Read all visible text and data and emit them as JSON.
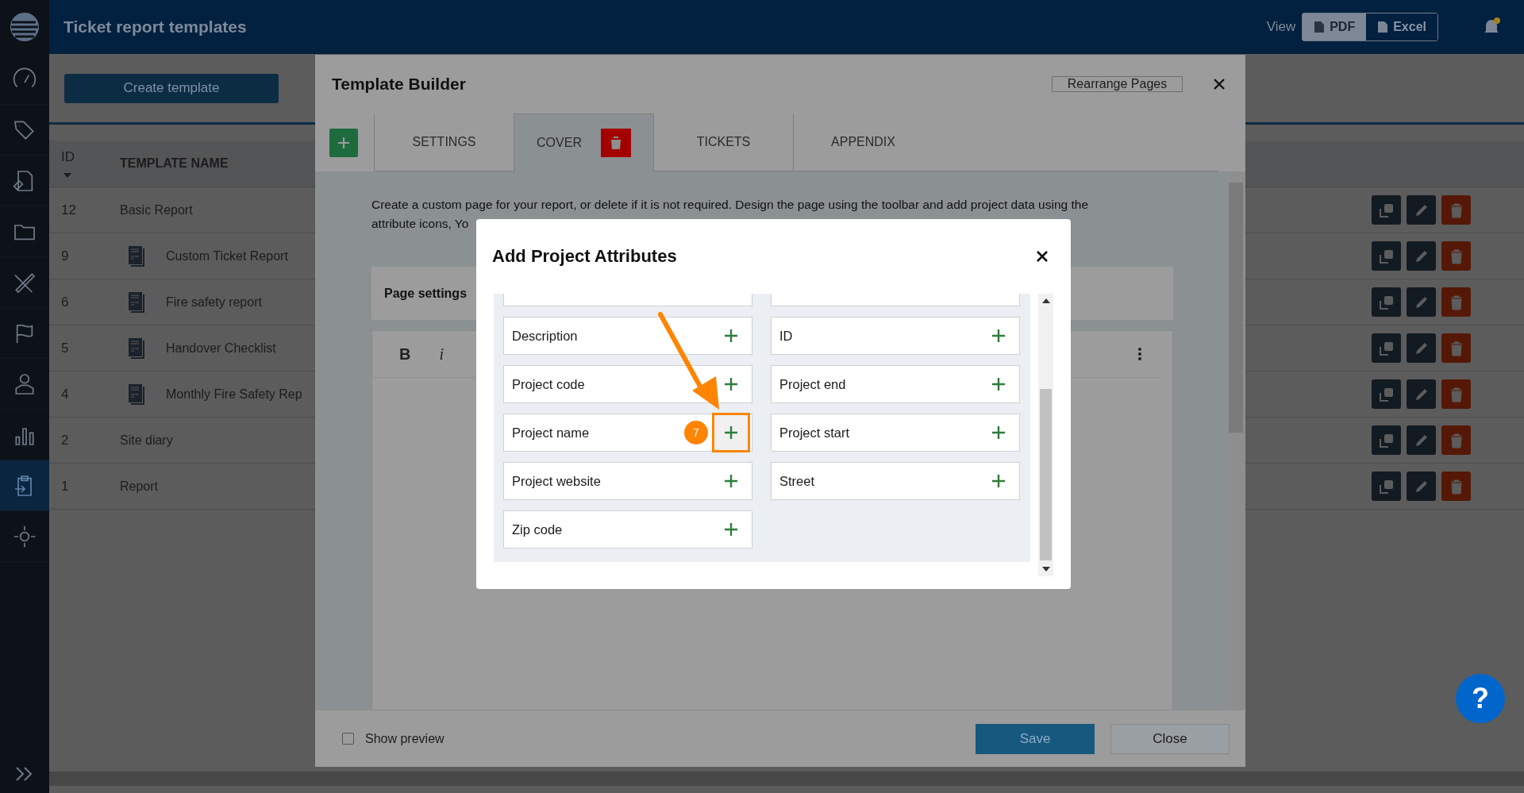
{
  "app": {
    "title": "Ticket report templates",
    "view_label": "View",
    "export_buttons": [
      "PDF",
      "Excel"
    ]
  },
  "sidebar": {
    "items": [
      {
        "selected": false
      },
      {
        "selected": false
      },
      {
        "selected": false
      },
      {
        "selected": false
      },
      {
        "selected": false
      },
      {
        "selected": false
      },
      {
        "selected": false
      },
      {
        "selected": false
      },
      {
        "selected": true
      },
      {
        "selected": false
      }
    ]
  },
  "create_button": "Create template",
  "table": {
    "columns": [
      "ID",
      "TEMPLATE NAME"
    ],
    "rows": [
      {
        "id": "12",
        "name": "Basic Report",
        "kind": "plain"
      },
      {
        "id": "9",
        "name": "Custom Ticket Report",
        "kind": "document"
      },
      {
        "id": "6",
        "name": "Fire safety report",
        "kind": "document"
      },
      {
        "id": "5",
        "name": "Handover Checklist",
        "kind": "document"
      },
      {
        "id": "4",
        "name": "Monthly Fire Safety Rep",
        "kind": "document"
      },
      {
        "id": "2",
        "name": "Site diary",
        "kind": "plain"
      },
      {
        "id": "1",
        "name": "Report",
        "kind": "plain"
      }
    ]
  },
  "builder": {
    "title": "Template Builder",
    "rearrange_button": "Rearrange Pages",
    "tabs": [
      {
        "label": "SETTINGS",
        "selected": false,
        "deletable": false
      },
      {
        "label": "COVER",
        "selected": true,
        "deletable": true
      },
      {
        "label": "TICKETS",
        "selected": false,
        "deletable": false
      },
      {
        "label": "APPENDIX",
        "selected": false,
        "deletable": false
      }
    ],
    "description_lines": [
      "Create a custom page for your report, or delete if it is not required. Design the page using the toolbar and add project data using the",
      "attribute icons, Yo"
    ],
    "page_settings": "Page settings",
    "toolbar": [
      "B",
      "i"
    ],
    "show_preview": {
      "label": "Show preview",
      "checked": false
    },
    "save_button": "Save",
    "close_button": "Close"
  },
  "dialog": {
    "title": "Add Project Attributes",
    "attributes": [
      {
        "label": "Description",
        "highlighted": false
      },
      {
        "label": "ID",
        "highlighted": false
      },
      {
        "label": "Project code",
        "highlighted": false
      },
      {
        "label": "Project end",
        "highlighted": false
      },
      {
        "label": "Project name",
        "highlighted": true,
        "step": "7"
      },
      {
        "label": "Project start",
        "highlighted": false
      },
      {
        "label": "Project website",
        "highlighted": false
      },
      {
        "label": "Street",
        "highlighted": false
      },
      {
        "label": "Zip code",
        "highlighted": false
      }
    ]
  },
  "help_button": "?"
}
